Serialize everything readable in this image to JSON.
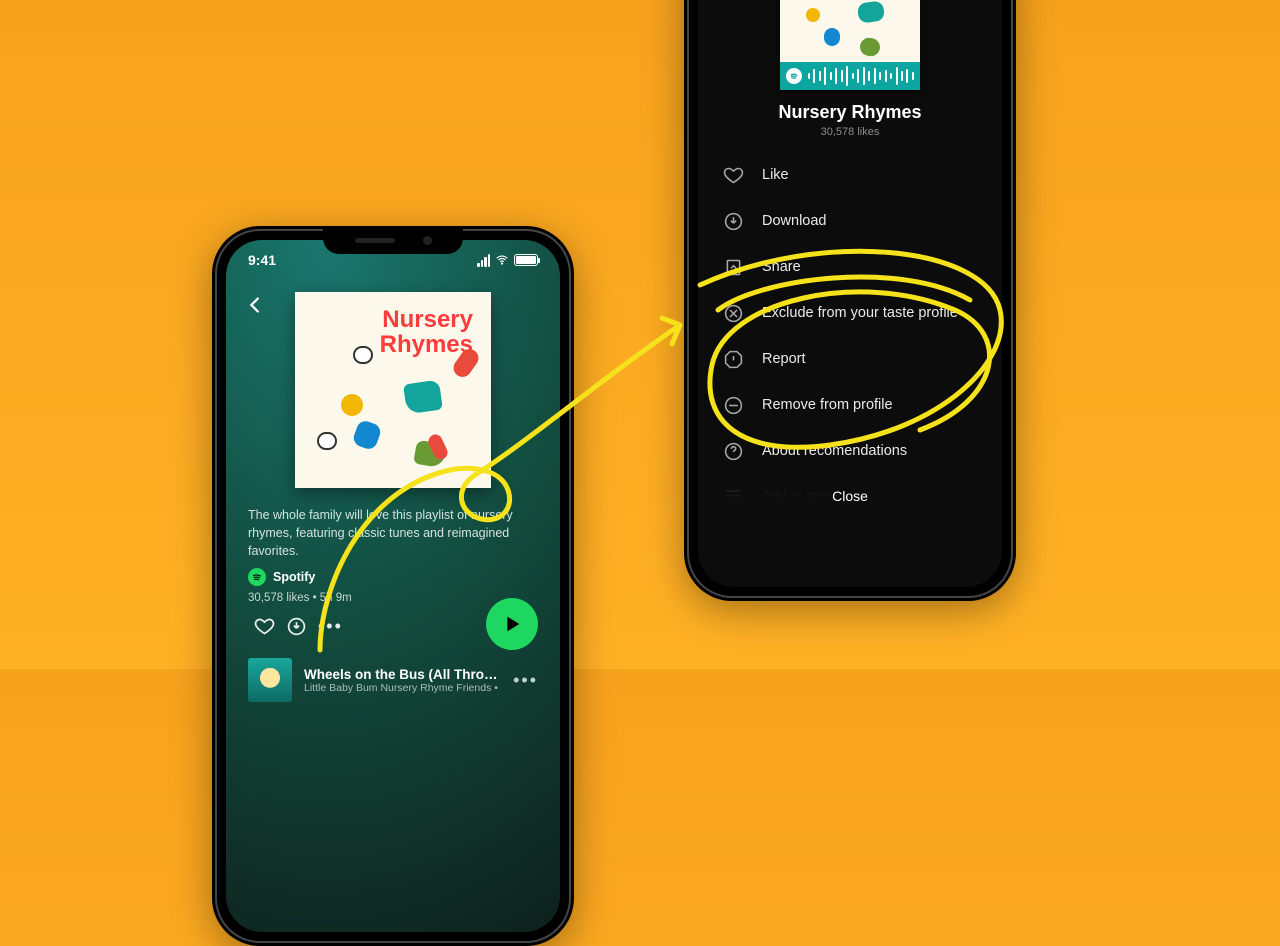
{
  "left_phone": {
    "status_time": "9:41",
    "playlist_title_line1": "Nursery",
    "playlist_title_line2": "Rhymes",
    "description": "The whole family will love this playlist of nursery rhymes, featuring classic tunes and reimagined favorites.",
    "author": "Spotify",
    "likes": "30,578 likes",
    "duration": "5h 9m",
    "meta_combined": "30,578 likes • 5h 9m",
    "track_title": "Wheels on the Bus (All Through t…",
    "track_subtitle": "Little Baby Bum Nursery Rhyme Friends •"
  },
  "right_phone": {
    "playlist_title": "Nursery Rhymes",
    "likes": "30,578 likes",
    "menu_like": "Like",
    "menu_download": "Download",
    "menu_share": "Share",
    "menu_exclude": "Exclude from your taste profile",
    "menu_report": "Report",
    "menu_remove": "Remove from profile",
    "menu_about": "About recomendations",
    "add_to_queue": "Add to queue",
    "close": "Close"
  },
  "colors": {
    "spotify_green": "#1ed760",
    "annotation_yellow": "#f6e21a"
  }
}
